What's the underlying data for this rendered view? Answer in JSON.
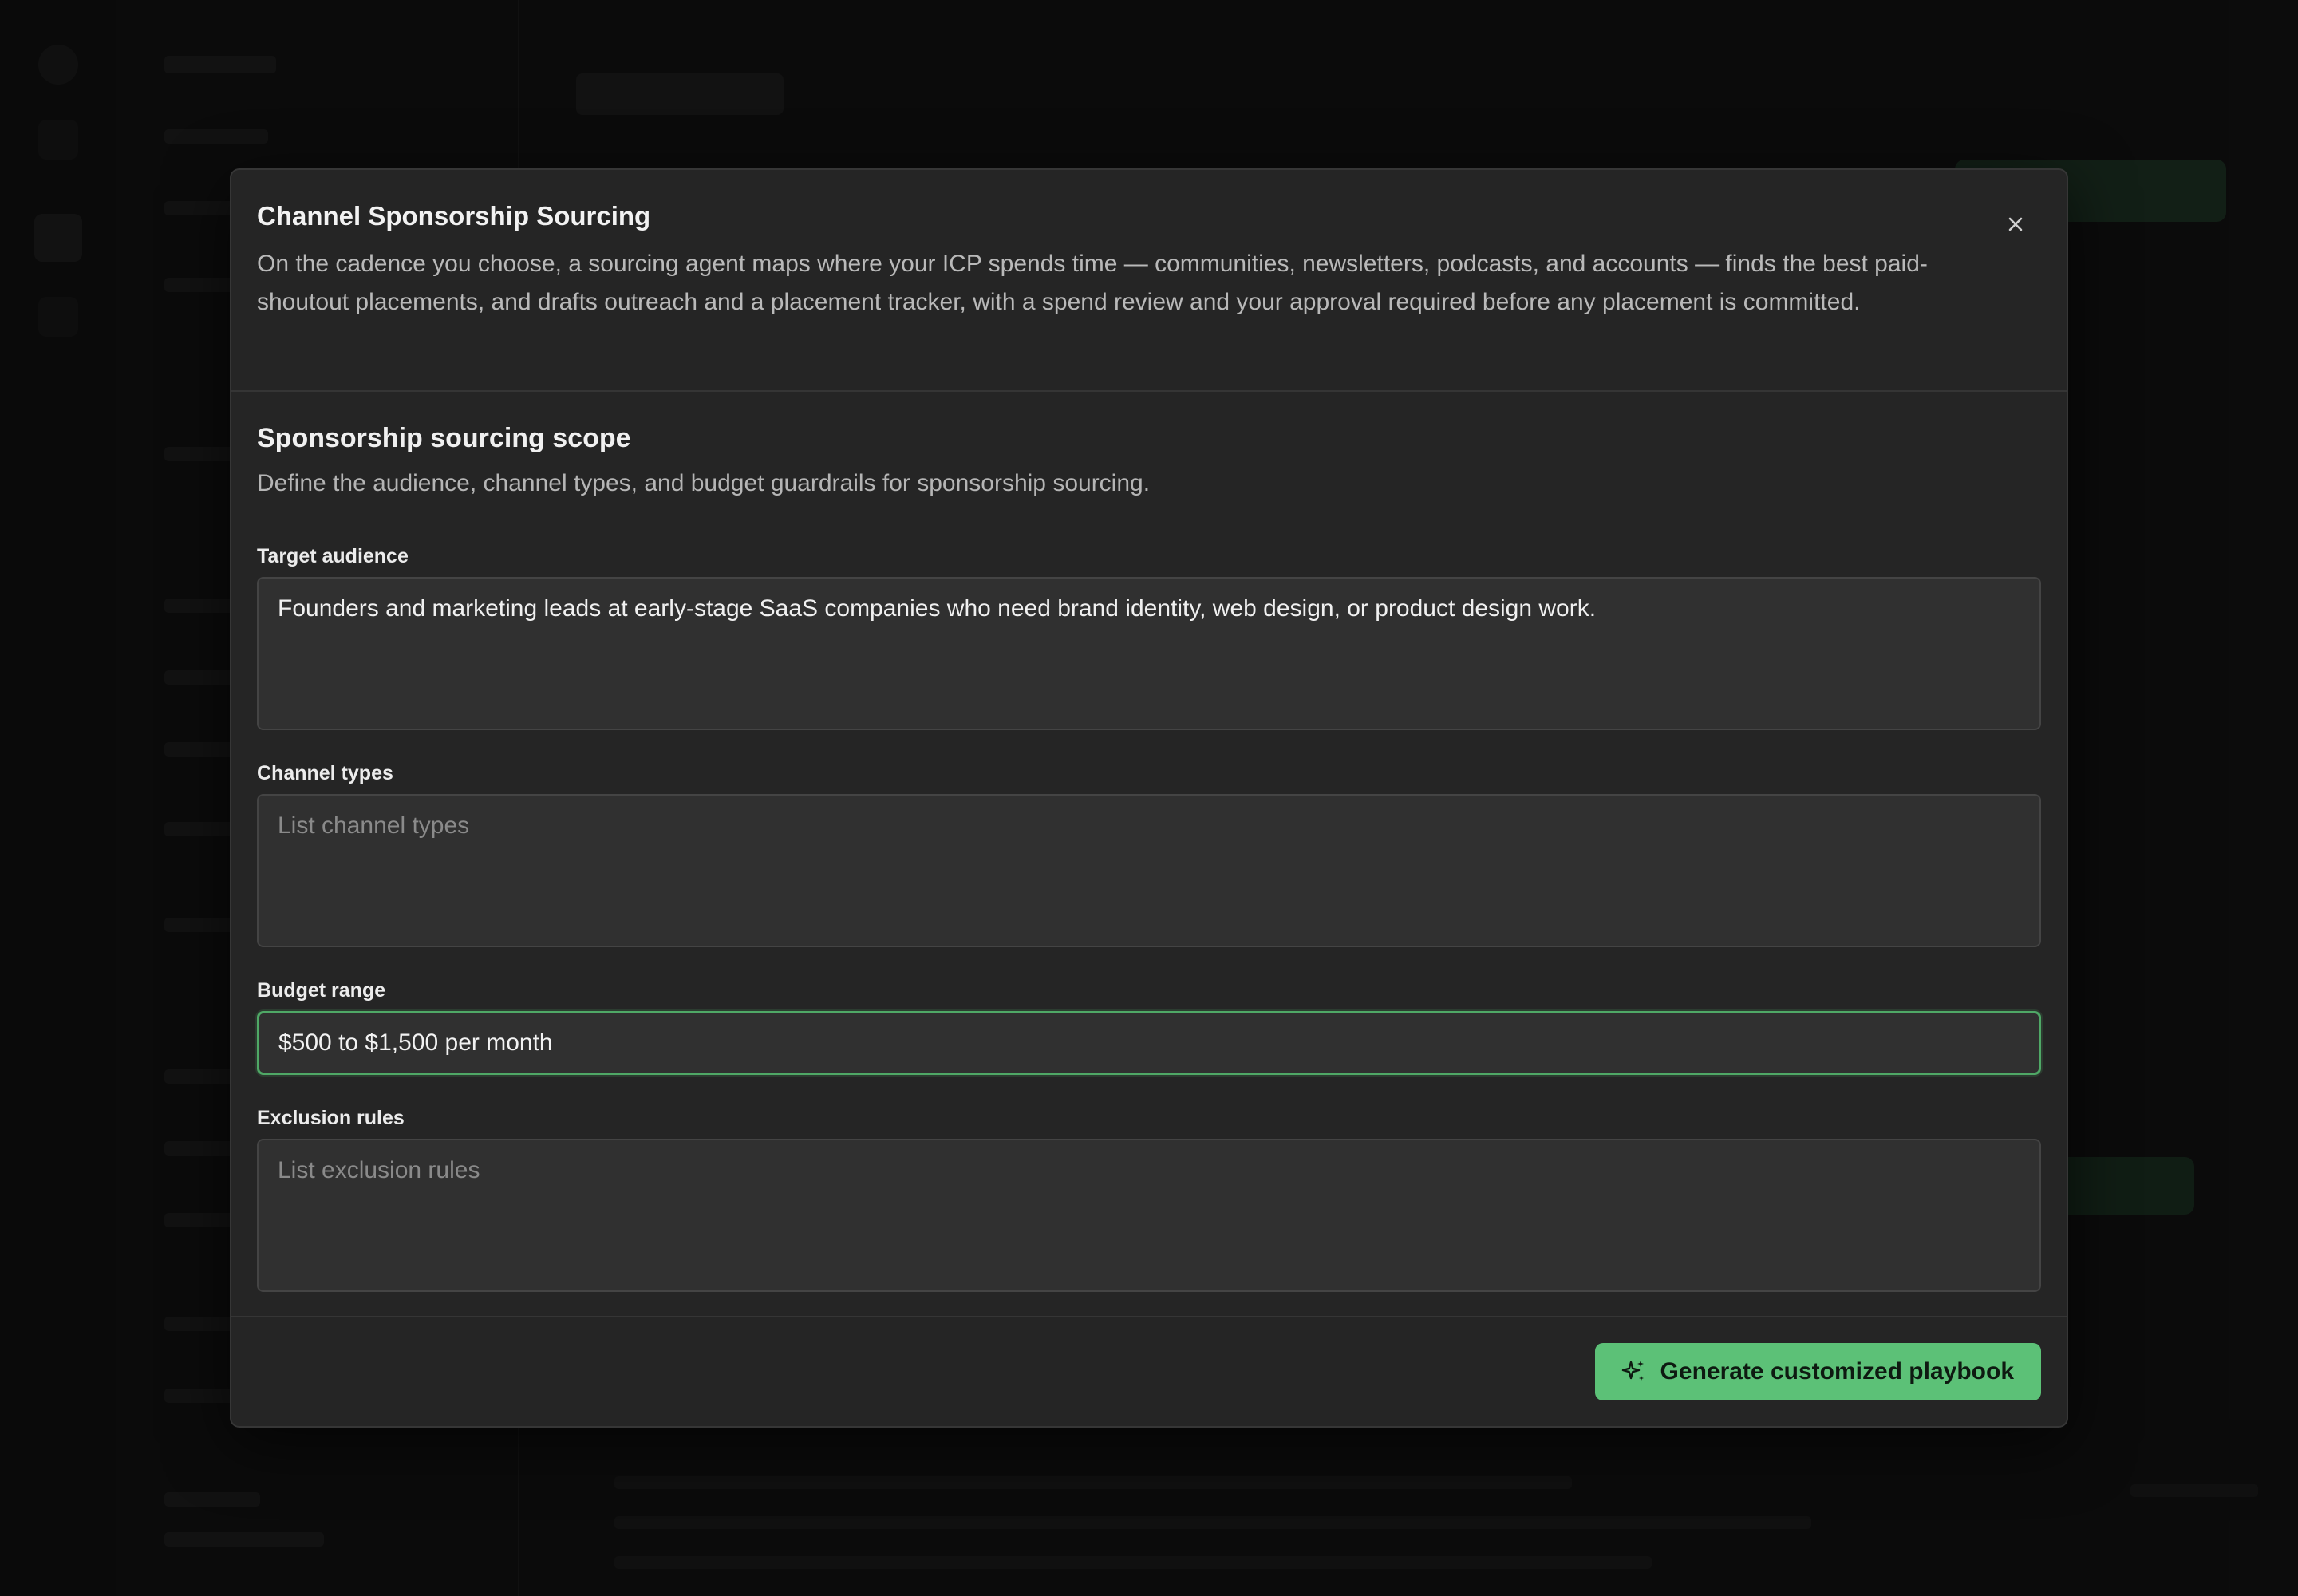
{
  "modal": {
    "title": "Channel Sponsorship Sourcing",
    "description": "On the cadence you choose, a sourcing agent maps where your ICP spends time — communities, newsletters, podcasts, and accounts — finds the best paid-shoutout placements, and drafts outreach and a placement tracker, with a spend review and your approval required before any placement is committed.",
    "close_icon": "close-icon"
  },
  "section": {
    "title": "Sponsorship sourcing scope",
    "description": "Define the audience, channel types, and budget guardrails for sponsorship sourcing."
  },
  "fields": {
    "target_audience": {
      "label": "Target audience",
      "value": "Founders and marketing leads at early-stage SaaS companies who need brand identity, web design, or product design work.",
      "placeholder": ""
    },
    "channel_types": {
      "label": "Channel types",
      "value": "",
      "placeholder": "List channel types"
    },
    "budget_range": {
      "label": "Budget range",
      "value": "$500 to $1,500 per month",
      "placeholder": ""
    },
    "exclusion_rules": {
      "label": "Exclusion rules",
      "value": "",
      "placeholder": "List exclusion rules"
    }
  },
  "footer": {
    "generate_label": "Generate customized playbook",
    "generate_icon": "sparkle-icon"
  },
  "colors": {
    "accent": "#5cc177",
    "focus_border": "#4fa866",
    "modal_bg": "#252525",
    "field_bg": "#303030"
  }
}
